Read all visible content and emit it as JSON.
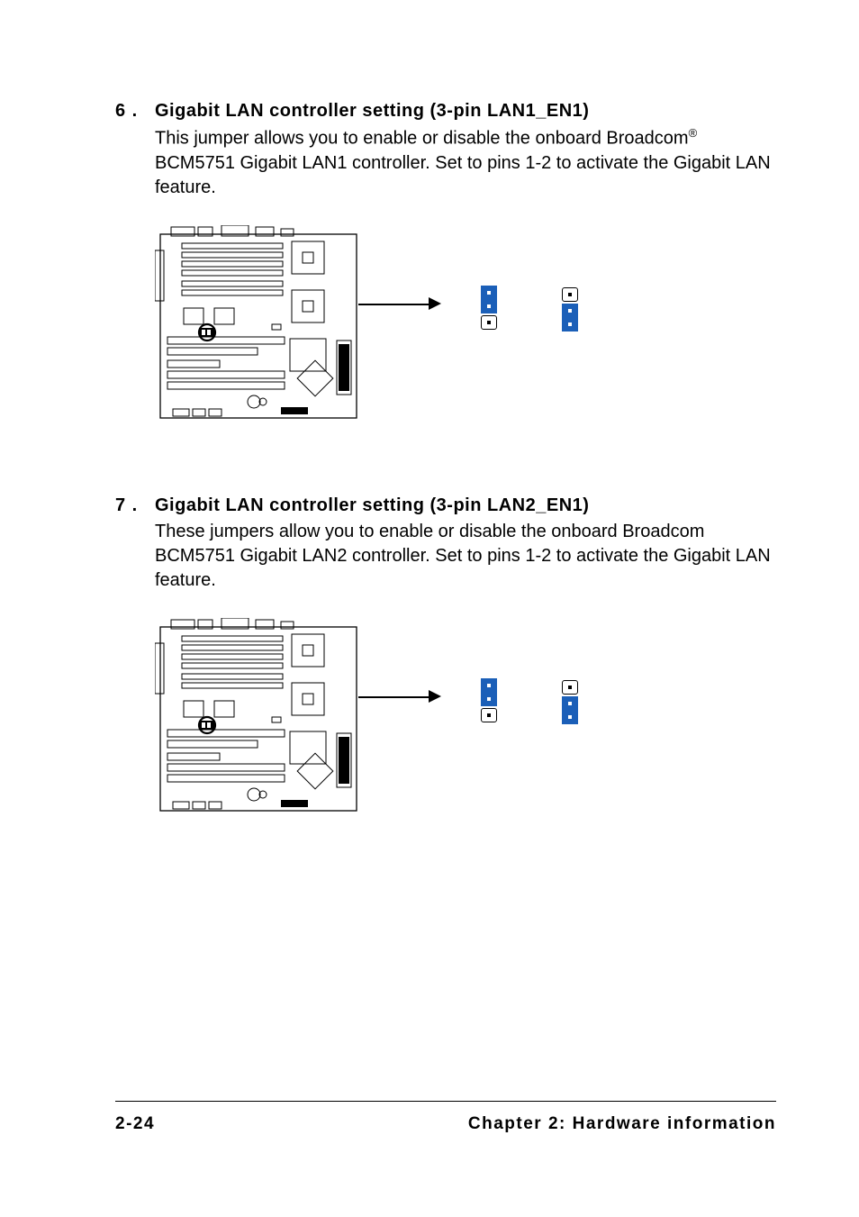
{
  "sections": [
    {
      "num": "6 .",
      "title": "Gigabit LAN controller setting (3-pin LAN1_EN1)",
      "body_pre": "This jumper allows you to enable or disable the onboard Broadcom",
      "body_post": " BCM5751 Gigabit LAN1 controller. Set to pins 1-2 to activate the Gigabit LAN feature.",
      "reg": "®",
      "jumper_a_covered": [
        true,
        true,
        false
      ],
      "jumper_b_covered": [
        false,
        true,
        true
      ]
    },
    {
      "num": "7 .",
      "title": "Gigabit LAN controller setting (3-pin LAN2_EN1)",
      "body_pre": "These jumpers allow you to enable or disable the onboard Broadcom BCM5751 Gigabit LAN2 controller. Set to pins 1-2 to activate the Gigabit LAN feature.",
      "body_post": "",
      "reg": "",
      "jumper_a_covered": [
        true,
        true,
        false
      ],
      "jumper_b_covered": [
        false,
        true,
        true
      ]
    }
  ],
  "footer": {
    "left": "2-24",
    "right": "Chapter 2: Hardware information"
  }
}
